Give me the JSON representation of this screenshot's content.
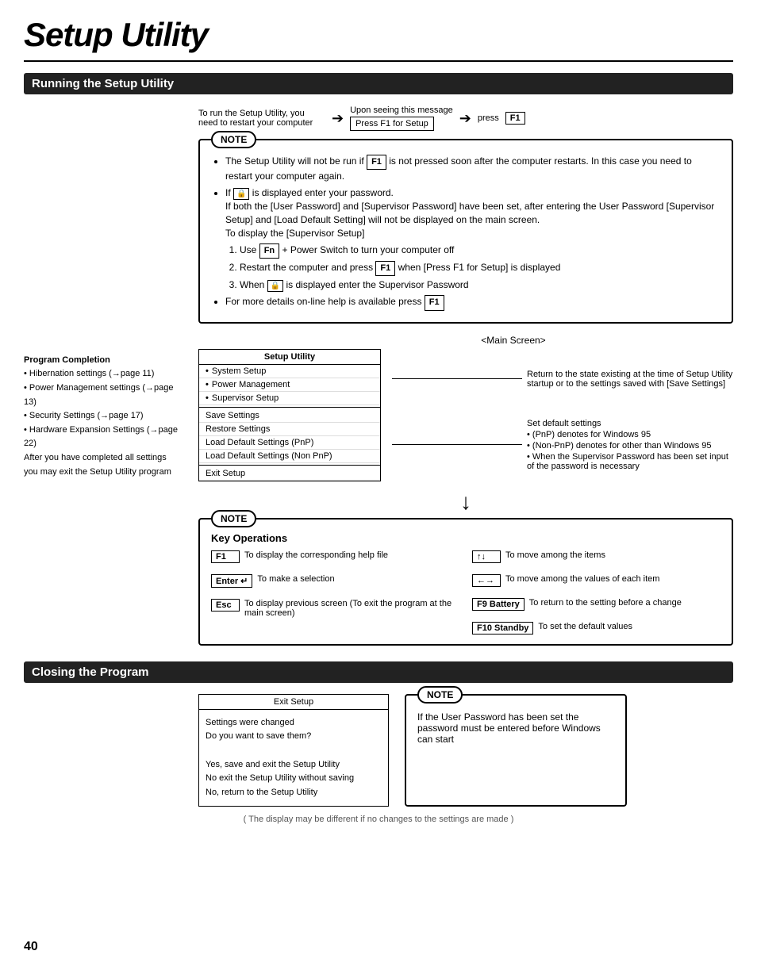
{
  "page": {
    "title": "Setup Utility",
    "page_number": "40"
  },
  "sections": {
    "running": {
      "header": "Running the Setup Utility",
      "restart_text": "To run the Setup Utility, you need to restart your computer",
      "upon_seeing": "Upon seeing this message",
      "press_setup": "Press F1 for Setup",
      "press_label": "press",
      "f1_key": "F1"
    },
    "note1": {
      "label": "NOTE",
      "bullets": [
        "The Setup Utility will not be run if [F1] is not pressed soon after the computer restarts. In this case you need to restart your computer again.",
        "If [icon] is displayed enter your password. If both the [User Password] and [Supervisor Password] have been set, after entering the User Password [Supervisor Setup] and [Load Default Setting] will not be displayed on the main screen.",
        "To display the [Supervisor Setup]"
      ],
      "steps": [
        "Use [Fn] + Power Switch to turn your computer off",
        "Restart the computer and press [F1] when [Press F1 for Setup] is displayed",
        "When [icon] is displayed enter the Supervisor Password"
      ],
      "last_bullet": "For more details on-line help is available press [F1]"
    },
    "main_screen": {
      "label": "<Main Screen>",
      "title": "Setup Utility",
      "items": [
        "•System Setup",
        "•Power Management",
        "•Supervisor Setup"
      ],
      "items2": [
        "Save Settings",
        "Restore Settings",
        "Load Default Settings (PnP)",
        "Load Default Settings (Non PnP)",
        "Exit Setup"
      ],
      "side_notes": [
        "Return to the state existing at the time of Setup Utility startup or to the settings saved with [Save Settings]",
        "Set default settings",
        "• (PnP) denotes for Windows 95",
        "• (Non-PnP) denotes for other than Windows 95",
        "• When the Supervisor Password has been set input of the password is necessary"
      ]
    },
    "program_completion": {
      "title": "Program Completion",
      "items": [
        "• Hibernation settings (page 11)",
        "• Power Management settings (page 13)",
        "• Security Settings (page 17)",
        "• Hardware Expansion Settings (page 22)",
        "After you have completed all settings you may exit the Setup Utility program"
      ]
    },
    "note2": {
      "label": "NOTE",
      "key_ops_title": "Key Operations",
      "ops": [
        {
          "key": "F1",
          "desc": "To display the corresponding help file"
        },
        {
          "key": "Enter",
          "desc": "To make a selection"
        },
        {
          "key": "Esc",
          "desc": "To display previous screen (To exit the program at the main screen)"
        }
      ],
      "ops_right": [
        {
          "key": "↑↓",
          "desc": "To move among the items"
        },
        {
          "key": "←→",
          "desc": "To move among the values of each item"
        },
        {
          "key": "F9 Battery",
          "desc": "To return to the setting before a change"
        },
        {
          "key": "F10 Standby",
          "desc": "To set the default values"
        }
      ]
    },
    "closing": {
      "header": "Closing the Program",
      "exit_box": {
        "title": "Exit Setup",
        "lines": [
          "Settings were changed",
          "Do you want to save them?",
          "",
          "Yes, save and exit the Setup Utility",
          "No exit the Setup Utility without saving",
          "No, return to the Setup Utility"
        ]
      },
      "note": {
        "label": "NOTE",
        "text": "If the User Password has been set the password must be entered before Windows can start"
      }
    },
    "footer": {
      "text": "( The display may be different if no changes to the settings are made )"
    }
  }
}
